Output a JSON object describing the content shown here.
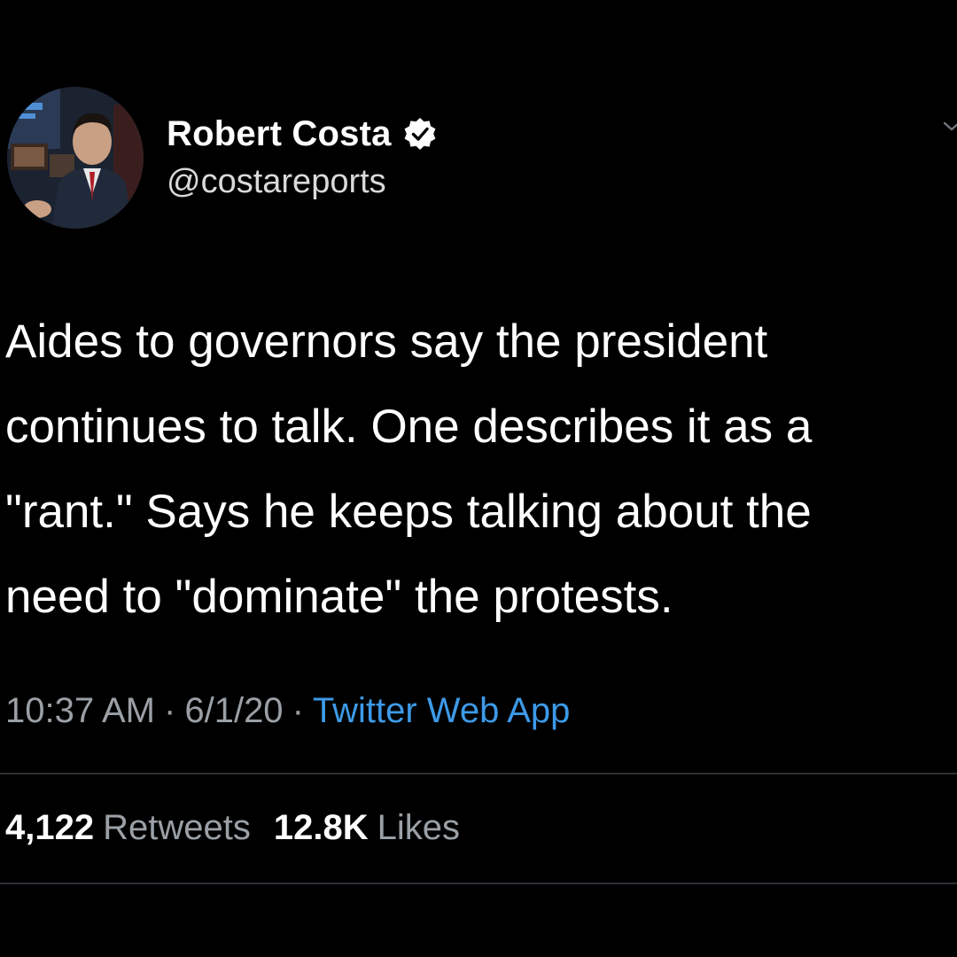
{
  "tweet": {
    "author": {
      "display_name": "Robert Costa",
      "handle": "@costareports",
      "verified": true,
      "avatar_icon": "profile-photo"
    },
    "text_lines": [
      "Aides to governors say the president",
      "continues to talk. One describes it as a",
      "\"rant.\" Says he keeps talking about the",
      "need to \"dominate\" the protests."
    ],
    "meta": {
      "time": "10:37 AM",
      "separator": "·",
      "date": "6/1/20",
      "source": "Twitter Web App"
    },
    "stats": {
      "retweets_count": "4,122",
      "retweets_label": "Retweets",
      "likes_count": "12.8K",
      "likes_label": "Likes"
    }
  },
  "colors": {
    "background": "#000000",
    "primary_text": "#ffffff",
    "secondary_text": "#9aa0a6",
    "link": "#3d9ae8",
    "divider": "#2a2f33"
  }
}
